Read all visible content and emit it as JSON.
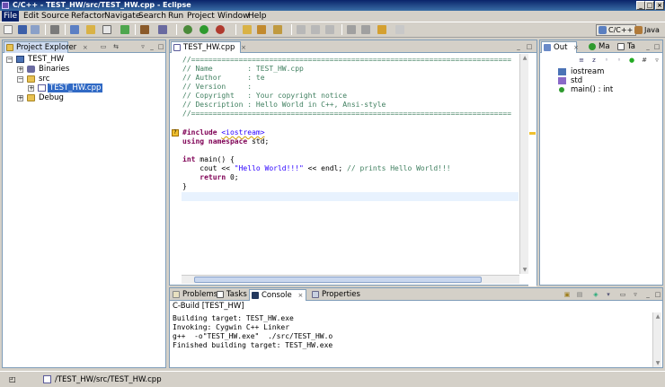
{
  "window": {
    "title": "C/C++ - TEST_HW/src/TEST_HW.cpp - Eclipse"
  },
  "menu": [
    "File",
    "Edit",
    "Source",
    "Refactor",
    "Navigate",
    "Search",
    "Run",
    "Project",
    "Window",
    "Help"
  ],
  "perspectives": {
    "active": "C/C++",
    "other": "Java"
  },
  "project_explorer": {
    "tab_label": "Project Explorer",
    "items": [
      "TEST_HW",
      "Binaries",
      "src",
      "TEST_HW.cpp",
      "Debug"
    ]
  },
  "editor": {
    "tab_label": "TEST_HW.cpp",
    "header_rule": "//==========================================================================",
    "header": [
      "// Name        : TEST_HW.cpp",
      "// Author      : te",
      "// Version     :",
      "// Copyright   : Your copyright notice",
      "// Description : Hello World in C++, Ansi-style"
    ],
    "include_directive": "#include",
    "include_target": "<iostream>",
    "using_line": {
      "kw": "using namespace",
      "rest": " std;"
    },
    "main_sig": {
      "kw": "int",
      "rest": " main() {"
    },
    "cout_line": {
      "pre": "    cout << ",
      "str": "\"Hello World!!!\"",
      "mid": " << endl; ",
      "cmt": "// prints Hello World!!!"
    },
    "return_line": {
      "kw": "return",
      "rest": " 0;"
    },
    "close_brace": "}"
  },
  "outline": {
    "tabs": [
      "Out",
      "Ma",
      "Ta"
    ],
    "items": [
      "iostream",
      "std",
      "main() : int"
    ]
  },
  "bottom": {
    "tabs": [
      "Problems",
      "Tasks",
      "Console",
      "Properties"
    ],
    "console_title": "C-Build [TEST_HW]",
    "console_lines": [
      "Building target: TEST_HW.exe",
      "Invoking: Cygwin C++ Linker",
      "g++  -o\"TEST_HW.exe\"  ./src/TEST_HW.o",
      "Finished building target: TEST_HW.exe"
    ]
  },
  "status": {
    "path": "/TEST_HW/src/TEST_HW.cpp"
  },
  "colors": {
    "selection": "#316ac5",
    "comment": "#3f7f5f",
    "keyword": "#7f0055",
    "string": "#2a00ff"
  }
}
